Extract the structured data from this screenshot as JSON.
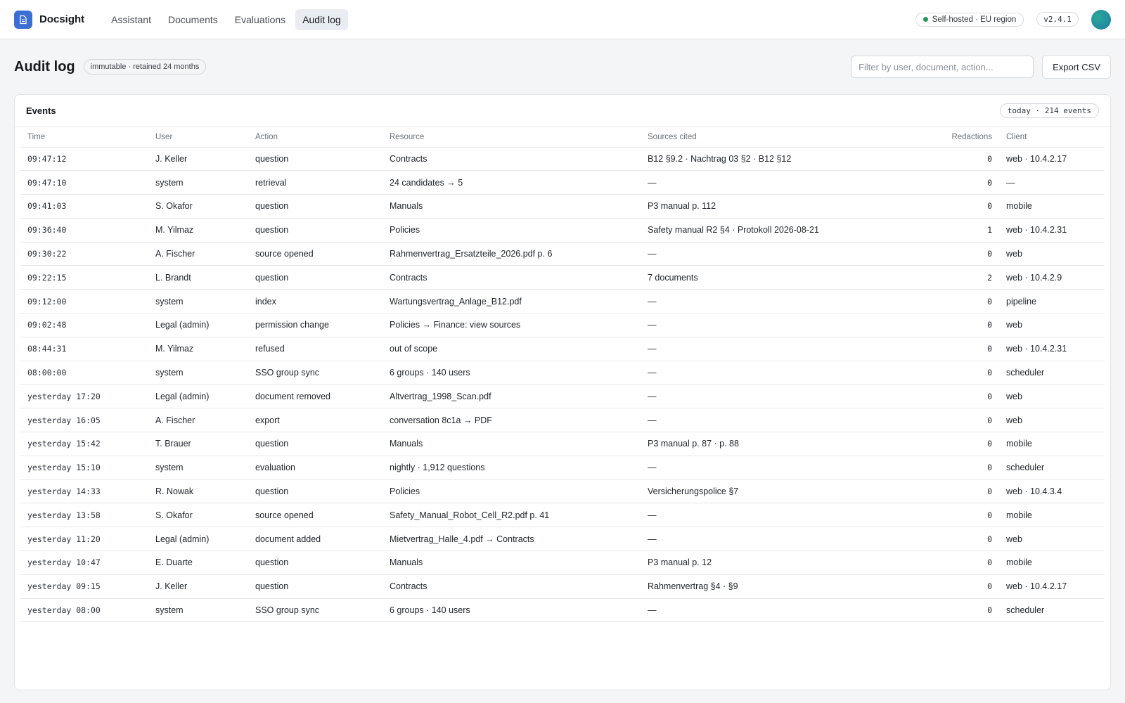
{
  "app": {
    "name": "Docsight",
    "nav": [
      "Assistant",
      "Documents",
      "Evaluations",
      "Audit log"
    ],
    "active_nav": "Audit log",
    "host_badge": "Self-hosted · EU region",
    "version": "v2.4.1"
  },
  "page": {
    "title": "Audit log",
    "retention_badge": "immutable · retained 24 months",
    "filter_placeholder": "Filter by user, document, action...",
    "export_label": "Export CSV"
  },
  "panel": {
    "title": "Events",
    "count_badge": "today · 214 events"
  },
  "columns": [
    "Time",
    "User",
    "Action",
    "Resource",
    "Sources cited",
    "Redactions",
    "Client"
  ],
  "rows": [
    [
      "09:47:12",
      "J. Keller",
      "question",
      "Contracts",
      "B12 §9.2 · Nachtrag 03 §2 · B12 §12",
      "0",
      "web · 10.4.2.17"
    ],
    [
      "09:47:10",
      "system",
      "retrieval",
      "24 candidates → 5",
      "—",
      "0",
      "—"
    ],
    [
      "09:41:03",
      "S. Okafor",
      "question",
      "Manuals",
      "P3 manual p. 112",
      "0",
      "mobile"
    ],
    [
      "09:36:40",
      "M. Yilmaz",
      "question",
      "Policies",
      "Safety manual R2 §4 · Protokoll 2026-08-21",
      "1",
      "web · 10.4.2.31"
    ],
    [
      "09:30:22",
      "A. Fischer",
      "source opened",
      "Rahmenvertrag_Ersatzteile_2026.pdf p. 6",
      "—",
      "0",
      "web"
    ],
    [
      "09:22:15",
      "L. Brandt",
      "question",
      "Contracts",
      "7 documents",
      "2",
      "web · 10.4.2.9"
    ],
    [
      "09:12:00",
      "system",
      "index",
      "Wartungsvertrag_Anlage_B12.pdf",
      "—",
      "0",
      "pipeline"
    ],
    [
      "09:02:48",
      "Legal (admin)",
      "permission change",
      "Policies → Finance: view sources",
      "—",
      "0",
      "web"
    ],
    [
      "08:44:31",
      "M. Yilmaz",
      "refused",
      "out of scope",
      "—",
      "0",
      "web · 10.4.2.31"
    ],
    [
      "08:00:00",
      "system",
      "SSO group sync",
      "6 groups · 140 users",
      "—",
      "0",
      "scheduler"
    ],
    [
      "yesterday 17:20",
      "Legal (admin)",
      "document removed",
      "Altvertrag_1998_Scan.pdf",
      "—",
      "0",
      "web"
    ],
    [
      "yesterday 16:05",
      "A. Fischer",
      "export",
      "conversation 8c1a → PDF",
      "—",
      "0",
      "web"
    ],
    [
      "yesterday 15:42",
      "T. Brauer",
      "question",
      "Manuals",
      "P3 manual p. 87 · p. 88",
      "0",
      "mobile"
    ],
    [
      "yesterday 15:10",
      "system",
      "evaluation",
      "nightly · 1,912 questions",
      "—",
      "0",
      "scheduler"
    ],
    [
      "yesterday 14:33",
      "R. Nowak",
      "question",
      "Policies",
      "Versicherungspolice §7",
      "0",
      "web · 10.4.3.4"
    ],
    [
      "yesterday 13:58",
      "S. Okafor",
      "source opened",
      "Safety_Manual_Robot_Cell_R2.pdf p. 41",
      "—",
      "0",
      "mobile"
    ],
    [
      "yesterday 11:20",
      "Legal (admin)",
      "document added",
      "Mietvertrag_Halle_4.pdf → Contracts",
      "—",
      "0",
      "web"
    ],
    [
      "yesterday 10:47",
      "E. Duarte",
      "question",
      "Manuals",
      "P3 manual p. 12",
      "0",
      "mobile"
    ],
    [
      "yesterday 09:15",
      "J. Keller",
      "question",
      "Contracts",
      "Rahmenvertrag §4 · §9",
      "0",
      "web · 10.4.2.17"
    ],
    [
      "yesterday 08:00",
      "system",
      "SSO group sync",
      "6 groups · 140 users",
      "—",
      "0",
      "scheduler"
    ]
  ],
  "colors": {
    "accent": "#3b6fd4",
    "status_ok": "#1f9d55"
  }
}
